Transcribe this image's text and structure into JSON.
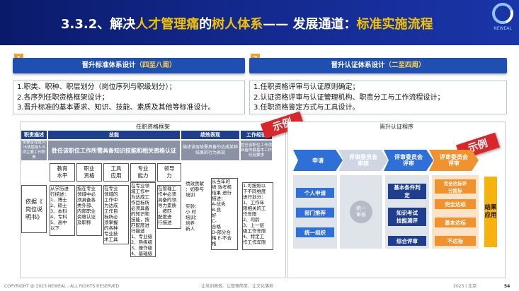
{
  "header": {
    "title_a": "3.3.2、解决",
    "title_b": "人才管理痛",
    "title_c": "的",
    "title_d": "树人体系",
    "title_e": "—— 发展通道：",
    "title_f": "标准实施流程",
    "logo_text": "NEWEAL"
  },
  "panel1": {
    "num": "1",
    "head": "晋升标准体系设计",
    "head_sub": "（四至八周）",
    "items": [
      "1.职类、职种、职层划分（岗位序列与职级划分）；",
      "2.各序列任职资格框架设计；",
      "3.晋升标准的基本要求、知识、技能、素质及其他等标准设计。"
    ]
  },
  "panel2": {
    "num": "2",
    "head": "晋升认证体系设计",
    "head_sub": "（二至四周）",
    "items": [
      "1.任职资格评审与认证原则确定；",
      "2.认证资格评审与认证管理机构、职责分工与工作流程设计；",
      "3.任职资格鉴定方式与工具设计。"
    ]
  },
  "left_card": {
    "title": "任职资格框架",
    "ribbon": "示例",
    "h_job": "职责描述",
    "h_skill": "技能",
    "h_perf": "绩效表现",
    "h_work": "工作经验",
    "d_job": "按要晋程度列出该层级5-8项主要工作职责",
    "d_skill": "胜任该职位工作所需具备知识技能和相关资格认证",
    "d_perf": "描述该层级需具备的达成某种结果的行为表现",
    "d_work": "胜任该职位工作须具备的最基本工作经验要求",
    "cols": [
      "教育\n水平",
      "职业\n资格",
      "工具\n应用",
      "专业\n能力",
      "领导\n力"
    ],
    "basis": "依据《\n岗位说\n明书》",
    "c_edu": "从学历进\n行描述：\n1、博士\n2、硕士\n3、本科\n4、专科\n5、高中\n以下",
    "c_qual": "指在专业\n领域中必\n须具备各\n类外部、\n内部职业\n资格认证\n及职称",
    "c_tool": "在专业\n领域的\n工作中\n为达成\n工作目\n标所必\n须掌握\n的各种\n专业技\n术工具",
    "c_pro": "在专业领\n域工作中\n为达成工\n作目标所\n必须具备\n的知识和\n技能，按\n匹配度进\n行描述\n1、专业级\n2、熟练级\n3、操作级\n4、基础级",
    "c_lead": "在管理工\n作中必须\n具备的领\n导力素质\n，按匹\n配度进\n行描述",
    "c_perf1": "绩效贡献\n：如参与\n培训\n\n实验：\n小 时\n培训：\n培养\n新人",
    "c_perf2": "从当年的\n绩 效考核\n结果 进行\n描述：\nA-优秀\nB-良\n好\nC-\n合格\nD-部分合\n格 E-不合\n格",
    "c_work": "1.可按照以\n下不同维度\n进行划分：\n1、工作年\n限相关的工\n作年限\n2、司龄\n3、上一层\n级工作年限\n4、特定工\n作工作年限"
  },
  "right_card": {
    "title": "晋升认证程序",
    "ribbon": "示例",
    "steps": [
      "申请",
      "评审委员会\n审核",
      "评审委员会\n评审",
      "评审委员会\n评审"
    ],
    "apply_items": [
      "个人申请",
      "部门推荐",
      "统一组织"
    ],
    "review_mid": "统一\n审核",
    "eval_items": [
      "基本条件判\n定",
      "知识考试\n技能测评",
      "综合评审"
    ],
    "result_items": [
      "完全达标评\n分超标",
      "完全达标",
      "基本达标",
      "不达标"
    ],
    "final": "结果\n应用"
  },
  "footer": {
    "copyright": "COPYRIGHT @ 2023 NEWEAL . ALL RIGHTS RESERVED",
    "slogan": "让培训高效、让管理简单、让文化落地",
    "place": "2023 | 北京",
    "page": "54"
  }
}
